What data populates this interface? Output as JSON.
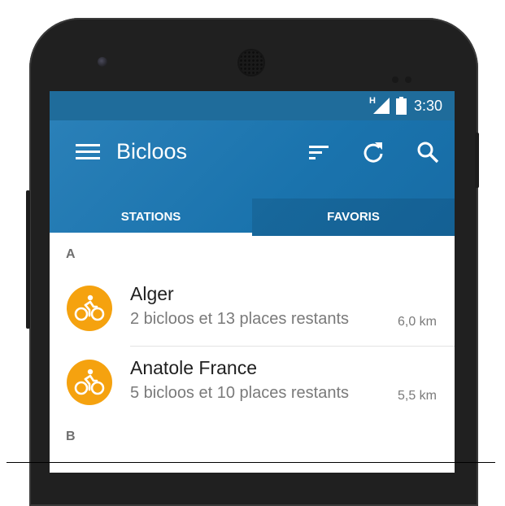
{
  "status_bar": {
    "network": "H",
    "time": "3:30"
  },
  "app_bar": {
    "title": "Bicloos",
    "actions": [
      "menu-icon",
      "sort-icon",
      "refresh-icon",
      "search-icon"
    ]
  },
  "tabs": [
    {
      "label": "STATIONS",
      "selected": true
    },
    {
      "label": "FAVORIS",
      "selected": false
    }
  ],
  "sections": [
    {
      "header": "A",
      "stations": [
        {
          "name": "Alger",
          "availability": "2 bicloos et 13 places restants",
          "distance": "6,0 km",
          "icon": "bike-icon"
        },
        {
          "name": "Anatole France",
          "availability": "5 bicloos et 10 places restants",
          "distance": "5,5 km",
          "icon": "bike-icon"
        }
      ]
    },
    {
      "header": "B",
      "stations": []
    }
  ],
  "colors": {
    "primary": "#1a73ad",
    "status_bar": "#1f6c9b",
    "accent_avatar": "#f5a20f"
  }
}
